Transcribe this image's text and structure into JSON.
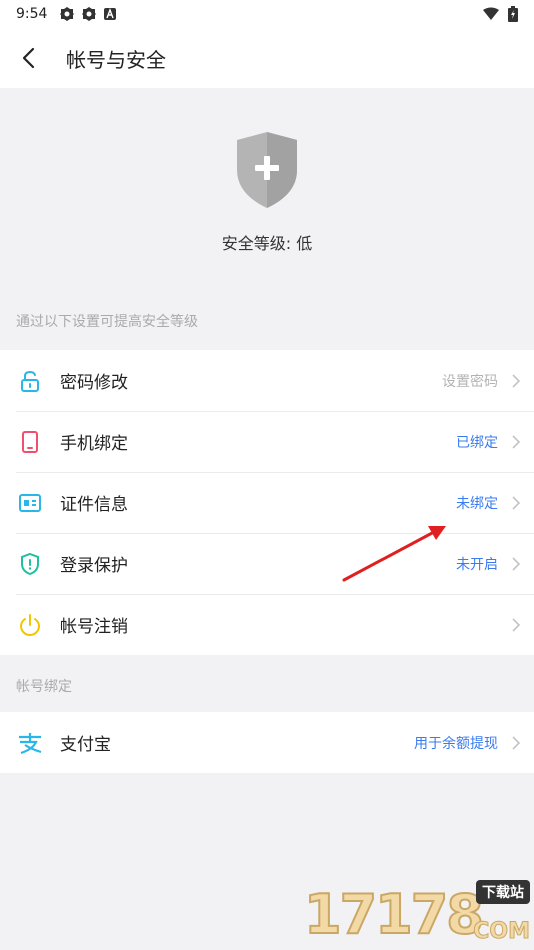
{
  "status_bar": {
    "time": "9:54",
    "left_icons": [
      "gear-icon",
      "gear-icon",
      "a-icon"
    ],
    "right_icons": [
      "wifi-icon",
      "battery-icon"
    ]
  },
  "header": {
    "title": "帐号与安全",
    "back_icon": "chevron-left-icon"
  },
  "hero": {
    "shield_icon": "shield-plus-icon",
    "level_text": "安全等级: 低"
  },
  "security_section": {
    "hint": "通过以下设置可提高安全等级",
    "items": [
      {
        "label": "密码修改",
        "value": "设置密码",
        "value_color": "gray",
        "icon": "unlock-icon"
      },
      {
        "label": "手机绑定",
        "value": "已绑定",
        "value_color": "blue",
        "icon": "phone-icon"
      },
      {
        "label": "证件信息",
        "value": "未绑定",
        "value_color": "blue",
        "icon": "id-card-icon"
      },
      {
        "label": "登录保护",
        "value": "未开启",
        "value_color": "blue",
        "icon": "shield-alert-icon"
      },
      {
        "label": "帐号注销",
        "value": "",
        "value_color": "gray",
        "icon": "power-icon"
      }
    ]
  },
  "binding_section": {
    "hint": "帐号绑定",
    "items": [
      {
        "label": "支付宝",
        "value": "用于余额提现",
        "value_color": "blue",
        "icon": "alipay-icon"
      }
    ]
  },
  "watermark": {
    "text": "17178",
    "badge": "下载站",
    "suffix": "COM"
  },
  "colors": {
    "accent_blue": "#3a7bf0",
    "gray_value": "#b3b3b3",
    "icon_cyan": "#29b6e8",
    "icon_red": "#f0506e",
    "icon_green": "#1fbfa0",
    "icon_yellow": "#f5c400",
    "background": "#f2f2f4",
    "annotation_arrow": "#e02020"
  }
}
